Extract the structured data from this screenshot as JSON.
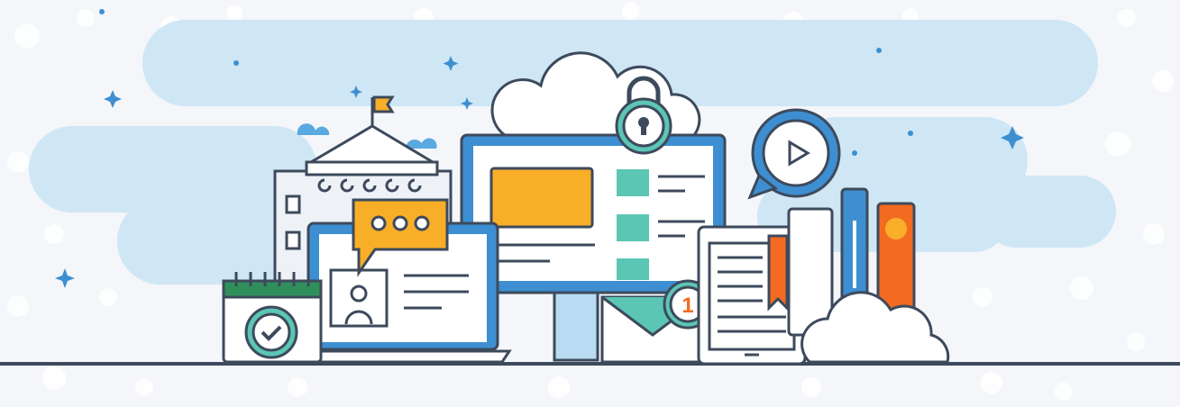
{
  "scene": {
    "description_visible_text": "",
    "colors": {
      "background": "#f4f6fa",
      "cloud_band": "#cfe6f5",
      "outline": "#3d4a5c",
      "blue": "#3d8fd1",
      "light_blue": "#b9dcf2",
      "teal": "#5cc6b4",
      "orange": "#f26b21",
      "yellow": "#f9ae28",
      "white": "#ffffff",
      "green": "#2f8f5b"
    }
  },
  "mail": {
    "notification_count": "1"
  },
  "chat_bubble": {
    "dots": "• • •"
  }
}
